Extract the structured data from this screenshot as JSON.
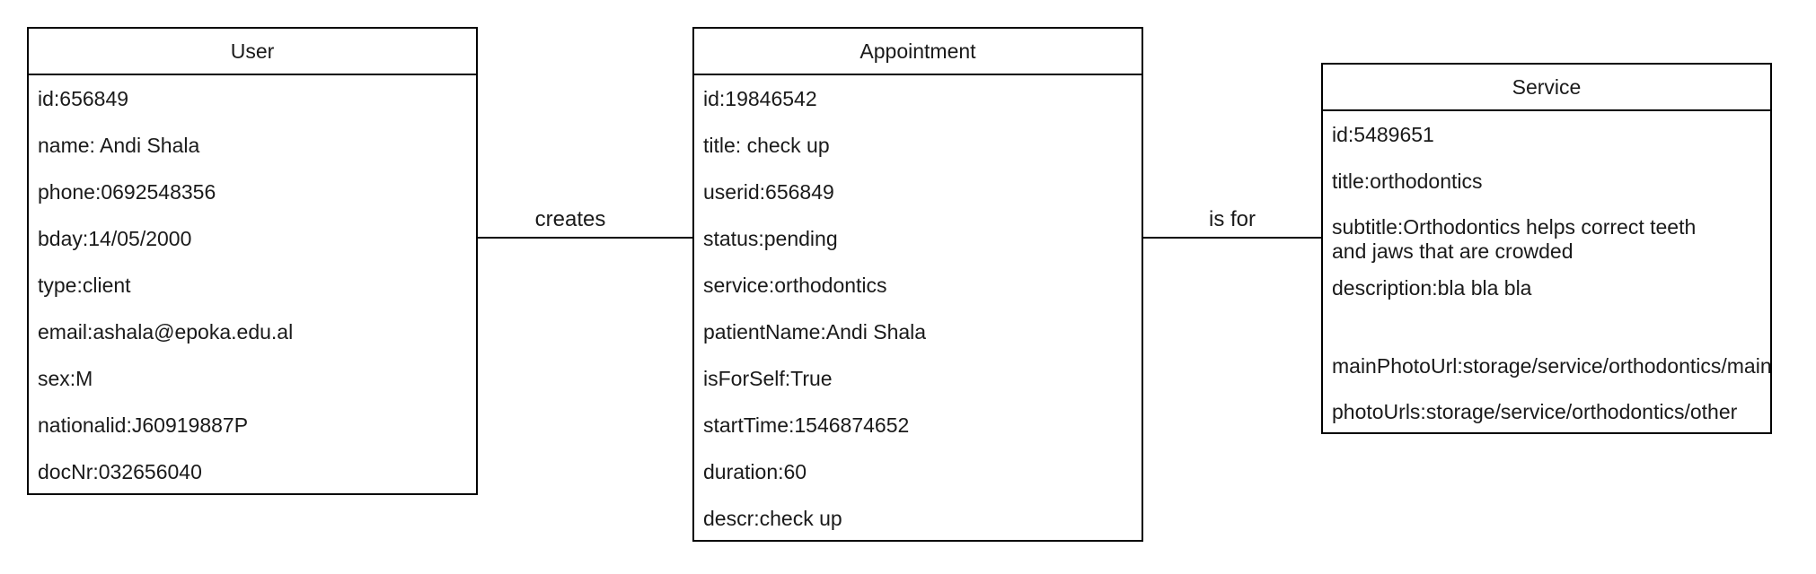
{
  "entities": {
    "user": {
      "title": "User",
      "attributes": [
        "id:656849",
        "name: Andi Shala",
        "phone:0692548356",
        "bday:14/05/2000",
        "type:client",
        "email:ashala@epoka.edu.al",
        "sex:M",
        "nationalid:J60919887P",
        "docNr:032656040"
      ]
    },
    "appointment": {
      "title": "Appointment",
      "attributes": [
        "id:19846542",
        "title: check up",
        "userid:656849",
        "status:pending",
        "service:orthodontics",
        "patientName:Andi Shala",
        "isForSelf:True",
        "startTime:1546874652",
        "duration:60",
        "descr:check up"
      ]
    },
    "service": {
      "title": "Service",
      "attributes": [
        "id:5489651",
        "title:orthodontics",
        "subtitle:Orthodontics helps correct teeth and jaws that are crowded",
        "description:bla bla bla",
        "mainPhotoUrl:storage/service/orthodontics/main",
        "photoUrls:storage/service/orthodontics/other"
      ]
    }
  },
  "relationships": {
    "creates": "creates",
    "is_for": "is for"
  }
}
